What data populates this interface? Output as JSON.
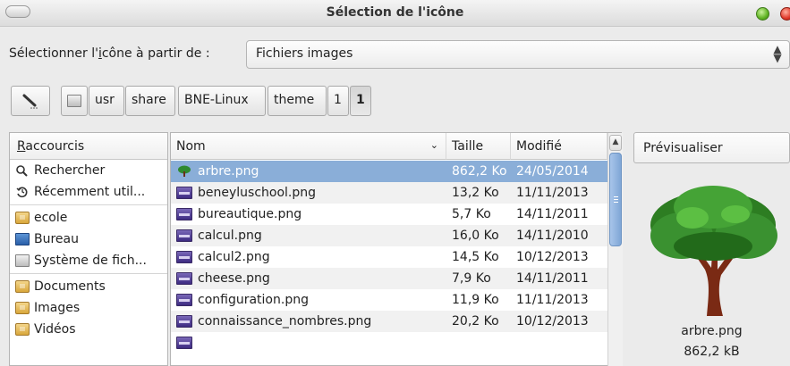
{
  "window": {
    "title": "Sélection de l'icône"
  },
  "source": {
    "label_before": "Sélectionner l'",
    "label_mnemonic": "i",
    "label_after": "cône à partir de :",
    "selected": "Fichiers images"
  },
  "pathbar": {
    "segments": [
      "usr",
      "share",
      "BNE-Linux",
      "theme",
      "1",
      "1"
    ]
  },
  "places": {
    "header_mnemonic": "R",
    "header_rest": "accourcis",
    "items": [
      {
        "label": "Rechercher",
        "icon": "search-icon"
      },
      {
        "label": "Récemment util...",
        "icon": "recent-icon"
      },
      {
        "label": "ecole",
        "icon": "folder-icon"
      },
      {
        "label": "Bureau",
        "icon": "desktop-icon"
      },
      {
        "label": "Système de fich...",
        "icon": "drive-icon"
      },
      {
        "label": "Documents",
        "icon": "folder-icon"
      },
      {
        "label": "Images",
        "icon": "folder-icon"
      },
      {
        "label": "Vidéos",
        "icon": "folder-icon"
      }
    ]
  },
  "files": {
    "columns": {
      "name": "Nom",
      "size": "Taille",
      "modified": "Modifié"
    },
    "rows": [
      {
        "name": "arbre.png",
        "size": "862,2 Ko",
        "date": "24/05/2014",
        "selected": true
      },
      {
        "name": "beneyluschool.png",
        "size": "13,2 Ko",
        "date": "11/11/2013"
      },
      {
        "name": "bureautique.png",
        "size": "5,7 Ko",
        "date": "14/11/2011"
      },
      {
        "name": "calcul.png",
        "size": "16,0 Ko",
        "date": "14/11/2010"
      },
      {
        "name": "calcul2.png",
        "size": "14,5 Ko",
        "date": "10/12/2013"
      },
      {
        "name": "cheese.png",
        "size": "7,9 Ko",
        "date": "14/11/2011"
      },
      {
        "name": "configuration.png",
        "size": "11,9 Ko",
        "date": "11/11/2013"
      },
      {
        "name": "connaissance_nombres.png",
        "size": "20,2 Ko",
        "date": "10/12/2013"
      }
    ]
  },
  "preview": {
    "header": "Prévisualiser",
    "filename": "arbre.png",
    "filesize": "862,2 kB"
  }
}
